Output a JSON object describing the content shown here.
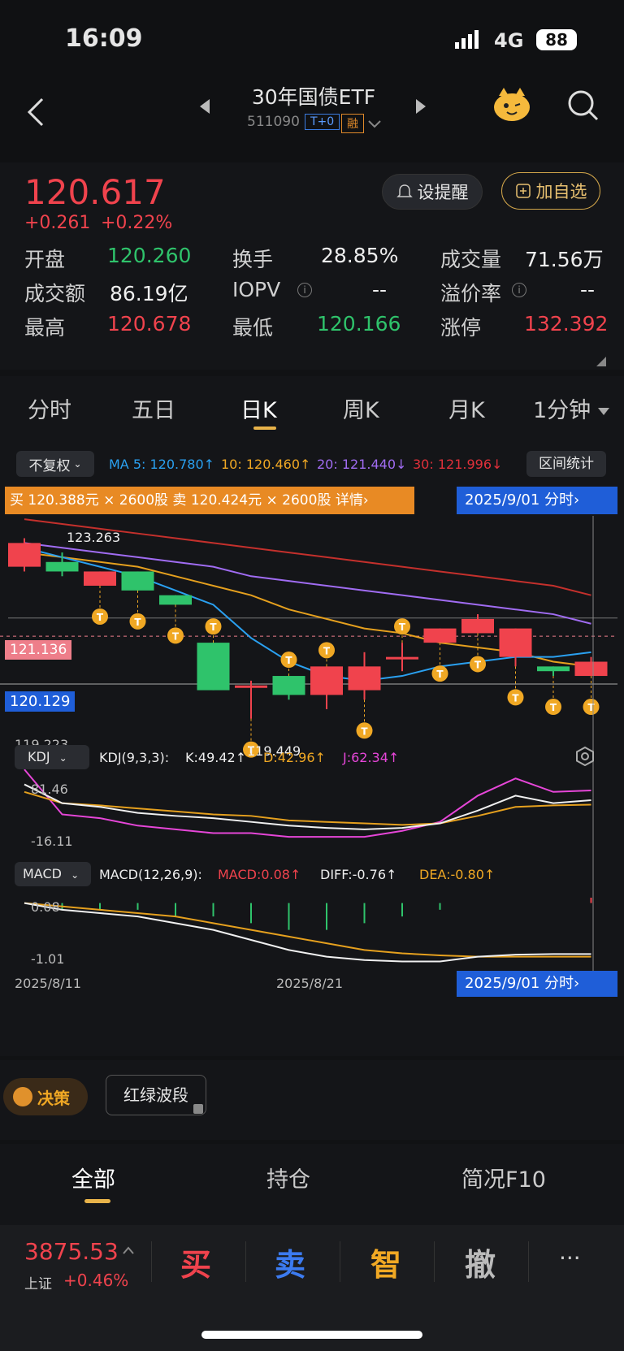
{
  "status": {
    "time": "16:09",
    "network": "4G",
    "battery": "88"
  },
  "header": {
    "title": "30年国债ETF",
    "code": "511090",
    "badge_t0": "T+0",
    "badge_rong": "融"
  },
  "quote": {
    "price": "120.617",
    "change": "+0.261",
    "change_pct": "+0.22%",
    "alert_label": "设提醒",
    "watch_label": "加自选",
    "rows": [
      [
        {
          "l": "开盘",
          "v": "120.260",
          "c": "green"
        },
        {
          "l": "换手",
          "v": "28.85%",
          "c": "white"
        },
        {
          "l": "成交量",
          "v": "71.56万",
          "c": "white"
        }
      ],
      [
        {
          "l": "成交额",
          "v": "86.19亿",
          "c": "white"
        },
        {
          "l": "IOPV",
          "v": "--",
          "c": "white"
        },
        {
          "l": "溢价率",
          "v": "--",
          "c": "white"
        }
      ],
      [
        {
          "l": "最高",
          "v": "120.678",
          "c": "red"
        },
        {
          "l": "最低",
          "v": "120.166",
          "c": "green"
        },
        {
          "l": "涨停",
          "v": "132.392",
          "c": "red"
        }
      ]
    ]
  },
  "tabs": [
    "分时",
    "五日",
    "日K",
    "周K",
    "月K",
    "1分钟"
  ],
  "active_tab": "日K",
  "chart_controls": {
    "adjust": "不复权",
    "ma5": "MA 5: 120.780↑",
    "ma10": "10: 120.460↑",
    "ma20": "20: 121.440↓",
    "ma30": "30: 121.996↓",
    "range_stats": "区间统计",
    "order_banner": "买 120.388元 × 2600股 卖 120.424元 × 2600股  详情›",
    "date_tag": "2025/9/01  分时›",
    "max_label": "123.263",
    "min_label": "119.449",
    "hl_red": "121.136",
    "hl_blue": "120.129",
    "y_low": "119.223",
    "kdj_btn": "KDJ",
    "kdj_params": "KDJ(9,3,3):",
    "kdj_k": "K:49.42↑",
    "kdj_d": "D:42.96↑",
    "kdj_j": "J:62.34↑",
    "kdj_top": "81.46",
    "kdj_bot": "-16.11",
    "macd_btn": "MACD",
    "macd_params": "MACD(12,26,9):",
    "macd_v": "MACD:0.08↑",
    "macd_diff": "DIFF:-0.76↑",
    "macd_dea": "DEA:-0.80↑",
    "macd_top": "0.08",
    "macd_bot": "-1.01",
    "date_start": "2025/8/11",
    "date_mid": "2025/8/21",
    "date_end": "2025/9/01  分时›",
    "trade_marker": "T"
  },
  "chart_data": {
    "type": "candlestick",
    "candles": [
      {
        "o": 122.6,
        "c": 123.1,
        "h": 123.2,
        "l": 122.5
      },
      {
        "o": 122.7,
        "c": 122.5,
        "h": 122.9,
        "l": 122.4
      },
      {
        "o": 122.2,
        "c": 122.5,
        "h": 122.5,
        "l": 122.2
      },
      {
        "o": 122.5,
        "c": 122.1,
        "h": 122.5,
        "l": 122.1
      },
      {
        "o": 122.0,
        "c": 121.8,
        "h": 122.0,
        "l": 121.8
      },
      {
        "o": 121.0,
        "c": 120.0,
        "h": 121.0,
        "l": 120.0
      },
      {
        "o": 120.1,
        "c": 120.1,
        "h": 120.2,
        "l": 119.4
      },
      {
        "o": 120.3,
        "c": 119.9,
        "h": 120.3,
        "l": 119.8
      },
      {
        "o": 119.9,
        "c": 120.5,
        "h": 120.5,
        "l": 119.6
      },
      {
        "o": 120.0,
        "c": 120.5,
        "h": 120.8,
        "l": 119.8
      },
      {
        "o": 120.7,
        "c": 120.7,
        "h": 121.0,
        "l": 120.4
      },
      {
        "o": 121.0,
        "c": 121.3,
        "h": 121.3,
        "l": 121.0
      },
      {
        "o": 121.2,
        "c": 121.5,
        "h": 121.6,
        "l": 121.2
      },
      {
        "o": 120.7,
        "c": 121.3,
        "h": 121.3,
        "l": 120.5
      },
      {
        "o": 120.5,
        "c": 120.4,
        "h": 120.5,
        "l": 120.3
      },
      {
        "o": 120.3,
        "c": 120.6,
        "h": 120.7,
        "l": 120.3
      }
    ],
    "ma5": [
      123.0,
      122.8,
      122.6,
      122.4,
      122.1,
      121.8,
      121.1,
      120.6,
      120.3,
      120.2,
      120.3,
      120.5,
      120.6,
      120.7,
      120.7,
      120.8
    ],
    "ma10": [
      122.9,
      122.8,
      122.7,
      122.6,
      122.4,
      122.2,
      122.0,
      121.7,
      121.5,
      121.3,
      121.2,
      121.0,
      120.9,
      120.8,
      120.6,
      120.5
    ],
    "ma20": [
      123.1,
      123.0,
      122.9,
      122.8,
      122.7,
      122.6,
      122.4,
      122.3,
      122.2,
      122.1,
      122.0,
      121.9,
      121.8,
      121.7,
      121.6,
      121.4
    ],
    "ma30": [
      123.6,
      123.5,
      123.4,
      123.3,
      123.2,
      123.1,
      123.0,
      122.9,
      122.8,
      122.7,
      122.6,
      122.5,
      122.4,
      122.3,
      122.2,
      122.0
    ],
    "ylim": [
      119.223,
      123.5
    ],
    "kdj_k": [
      70,
      45,
      40,
      32,
      28,
      25,
      20,
      15,
      12,
      10,
      12,
      18,
      35,
      55,
      45,
      49
    ],
    "kdj_d": [
      60,
      45,
      42,
      38,
      34,
      30,
      28,
      22,
      20,
      18,
      16,
      18,
      28,
      40,
      42,
      43
    ],
    "kdj_j": [
      90,
      30,
      25,
      15,
      10,
      5,
      5,
      0,
      0,
      0,
      8,
      20,
      55,
      78,
      60,
      62
    ],
    "macd_diff": [
      0,
      -0.1,
      -0.15,
      -0.2,
      -0.3,
      -0.4,
      -0.55,
      -0.7,
      -0.8,
      -0.85,
      -0.87,
      -0.87,
      -0.8,
      -0.77,
      -0.76,
      -0.76
    ],
    "macd_dea": [
      0,
      -0.05,
      -0.1,
      -0.15,
      -0.2,
      -0.3,
      -0.4,
      -0.5,
      -0.6,
      -0.7,
      -0.75,
      -0.78,
      -0.8,
      -0.8,
      -0.8,
      -0.8
    ],
    "macd_hist": [
      0,
      -0.1,
      -0.1,
      -0.1,
      -0.2,
      -0.2,
      -0.3,
      -0.4,
      -0.4,
      -0.3,
      -0.2,
      -0.1,
      0,
      0,
      0,
      0.08
    ]
  },
  "extras": {
    "decision": "决策",
    "wave": "红绿波段"
  },
  "bottom_tabs": [
    "全部",
    "持仓",
    "简况F10"
  ],
  "bottom_bar": {
    "index_value": "3875.53",
    "index_name": "上证",
    "index_change": "+0.46%",
    "buy": "买",
    "sell": "卖",
    "smart": "智",
    "cancel": "撤",
    "more": "···"
  }
}
